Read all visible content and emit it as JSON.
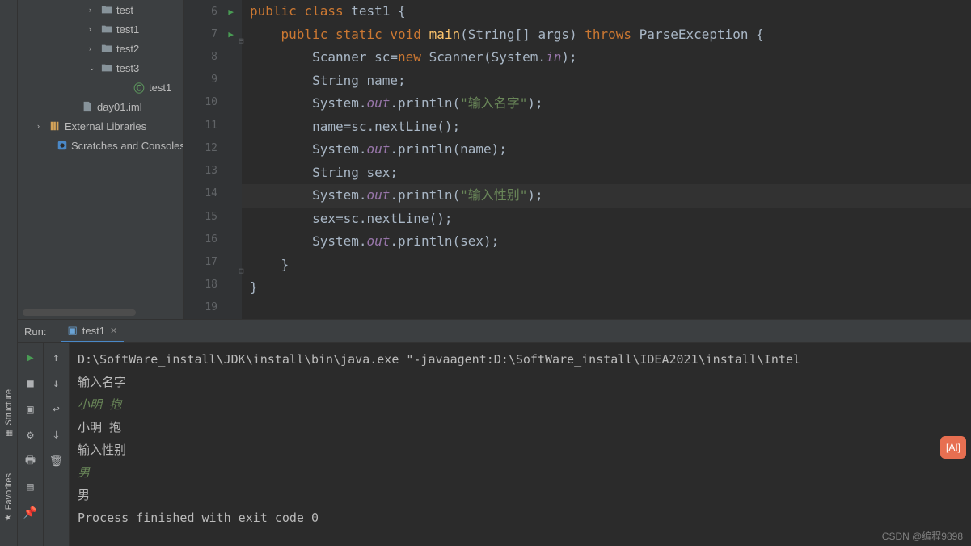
{
  "leftStrip": {
    "structure": "Structure",
    "favorites": "Favorites"
  },
  "tree": {
    "items": [
      {
        "indent": 88,
        "chev": "›",
        "icon": "folder",
        "label": "test"
      },
      {
        "indent": 88,
        "chev": "›",
        "icon": "folder",
        "label": "test1"
      },
      {
        "indent": 88,
        "chev": "›",
        "icon": "folder",
        "label": "test2"
      },
      {
        "indent": 88,
        "chev": "⌄",
        "icon": "folder",
        "label": "test3"
      },
      {
        "indent": 128,
        "chev": "",
        "icon": "class",
        "label": "test1"
      },
      {
        "indent": 64,
        "chev": "",
        "icon": "file",
        "label": "day01.iml"
      },
      {
        "indent": 24,
        "chev": "›",
        "icon": "lib",
        "label": "External Libraries"
      },
      {
        "indent": 44,
        "chev": "",
        "icon": "scratch",
        "label": "Scratches and Consoles"
      }
    ]
  },
  "editor": {
    "startLine": 6,
    "runMarkers": [
      6,
      7
    ],
    "currentLine": 14,
    "lines": [
      {
        "indent": 0,
        "tokens": [
          [
            "kw",
            "public "
          ],
          [
            "kw",
            "class "
          ],
          [
            "cls",
            "test1 "
          ],
          [
            "",
            "{"
          ]
        ]
      },
      {
        "indent": 1,
        "tokens": [
          [
            "kw",
            "public "
          ],
          [
            "kw",
            "static "
          ],
          [
            "kw",
            "void "
          ],
          [
            "fn",
            "main"
          ],
          [
            "",
            "(String[] args) "
          ],
          [
            "kw",
            "throws "
          ],
          [
            "",
            "ParseException {"
          ]
        ],
        "fold": true
      },
      {
        "indent": 2,
        "tokens": [
          [
            "",
            "Scanner sc="
          ],
          [
            "kw",
            "new "
          ],
          [
            "",
            "Scanner(System."
          ],
          [
            "fld",
            "in"
          ],
          [
            "",
            ");"
          ]
        ]
      },
      {
        "indent": 2,
        "tokens": [
          [
            "",
            "String name;"
          ]
        ]
      },
      {
        "indent": 2,
        "tokens": [
          [
            "",
            "System."
          ],
          [
            "fld",
            "out"
          ],
          [
            "",
            ".println("
          ],
          [
            "str",
            "\"输入名字\""
          ],
          [
            "",
            ");"
          ]
        ]
      },
      {
        "indent": 2,
        "tokens": [
          [
            "",
            "name=sc.nextLine();"
          ]
        ]
      },
      {
        "indent": 2,
        "tokens": [
          [
            "",
            "System."
          ],
          [
            "fld",
            "out"
          ],
          [
            "",
            ".println(name);"
          ]
        ]
      },
      {
        "indent": 2,
        "tokens": [
          [
            "",
            "String sex;"
          ]
        ]
      },
      {
        "indent": 2,
        "tokens": [
          [
            "",
            "System."
          ],
          [
            "fld",
            "out"
          ],
          [
            "",
            ".println("
          ],
          [
            "str",
            "\"输入性别\""
          ],
          [
            "",
            ");"
          ]
        ]
      },
      {
        "indent": 2,
        "tokens": [
          [
            "",
            "sex=sc.nextLine();"
          ]
        ]
      },
      {
        "indent": 2,
        "tokens": [
          [
            "",
            "System."
          ],
          [
            "fld",
            "out"
          ],
          [
            "",
            ".println(sex);"
          ]
        ]
      },
      {
        "indent": 1,
        "tokens": [
          [
            "",
            "}"
          ]
        ],
        "fold": true
      },
      {
        "indent": 0,
        "tokens": [
          [
            "",
            "}"
          ]
        ]
      },
      {
        "indent": 0,
        "tokens": [
          [
            "",
            ""
          ]
        ]
      }
    ]
  },
  "run": {
    "label": "Run:",
    "tabName": "test1",
    "console": [
      {
        "cls": "",
        "text": "D:\\SoftWare_install\\JDK\\install\\bin\\java.exe \"-javaagent:D:\\SoftWare_install\\IDEA2021\\install\\Intel"
      },
      {
        "cls": "",
        "text": "输入名字"
      },
      {
        "cls": "input-line",
        "text": "小明 抱"
      },
      {
        "cls": "",
        "text": "小明 抱"
      },
      {
        "cls": "",
        "text": "输入性别"
      },
      {
        "cls": "input-line",
        "text": "男"
      },
      {
        "cls": "",
        "text": "男"
      },
      {
        "cls": "",
        "text": ""
      },
      {
        "cls": "",
        "text": "Process finished with exit code 0"
      }
    ]
  },
  "watermark": "CSDN @编程9898"
}
